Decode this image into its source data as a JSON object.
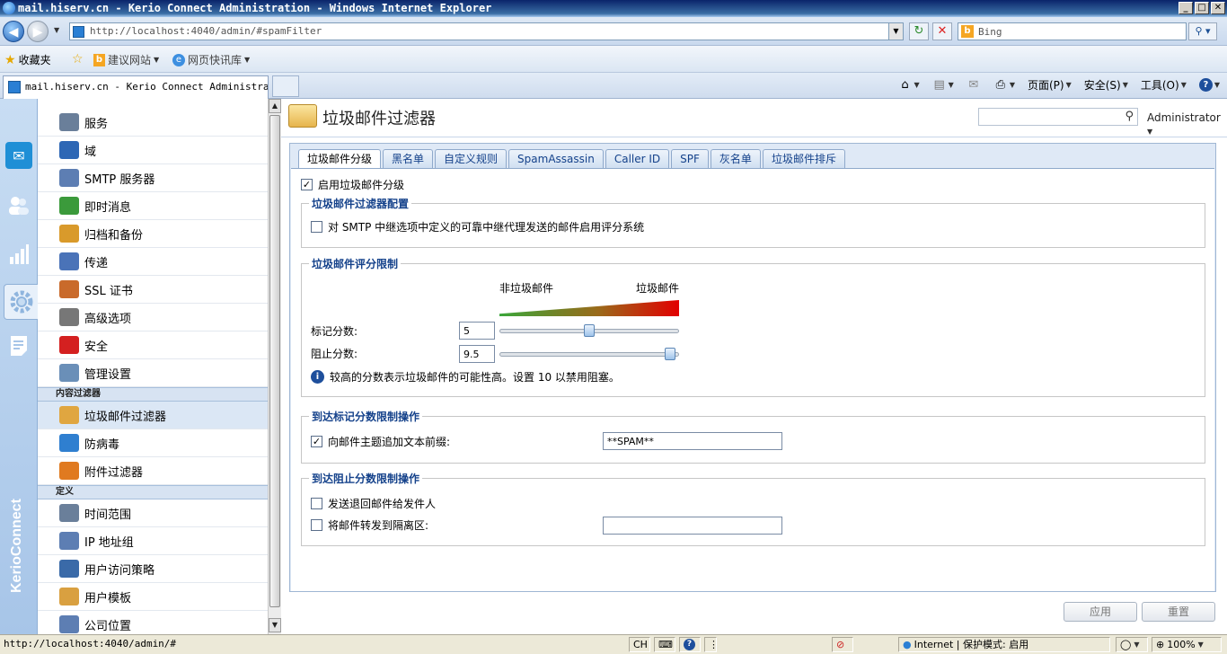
{
  "window": {
    "title": "mail.hiserv.cn - Kerio Connect Administration - Windows Internet Explorer",
    "buttons": {
      "minimize": "_",
      "maximize": "□",
      "close": "✕"
    }
  },
  "browser": {
    "url": "http://localhost:4040/admin/#spamFilter",
    "search_placeholder": "Bing",
    "favorites_label": "收藏夹",
    "suggested_sites": "建议网站",
    "web_slice_gallery": "网页快讯库",
    "tab_title": "mail.hiserv.cn - Kerio Connect Administra...",
    "commands": {
      "page": "页面(P)",
      "safety": "安全(S)",
      "tools": "工具(O)"
    }
  },
  "sidebar": {
    "items_top": [
      {
        "label": "服务",
        "icon": "services-icon",
        "color": "#6a7f9a"
      },
      {
        "label": "域",
        "icon": "at-sign-icon",
        "color": "#2d67b5"
      },
      {
        "label": "SMTP 服务器",
        "icon": "smtp-server-icon",
        "color": "#5d7eb3"
      },
      {
        "label": "即时消息",
        "icon": "chat-bubbles-icon",
        "color": "#3b9a3b"
      },
      {
        "label": "归档和备份",
        "icon": "archive-icon",
        "color": "#d99a2b"
      },
      {
        "label": "传递",
        "icon": "delivery-icon",
        "color": "#4a73b8"
      },
      {
        "label": "SSL 证书",
        "icon": "certificate-icon",
        "color": "#c96a2b"
      },
      {
        "label": "高级选项",
        "icon": "gears-icon",
        "color": "#777777"
      },
      {
        "label": "安全",
        "icon": "security-hand-icon",
        "color": "#d42020"
      },
      {
        "label": "管理设置",
        "icon": "admin-settings-icon",
        "color": "#6a8fb8"
      }
    ],
    "section_content_filter": "内容过滤器",
    "items_filter": [
      {
        "label": "垃圾邮件过滤器",
        "icon": "spam-filter-icon",
        "color": "#e0a640"
      },
      {
        "label": "防病毒",
        "icon": "antivirus-icon",
        "color": "#2f7fd0"
      },
      {
        "label": "附件过滤器",
        "icon": "attachment-filter-icon",
        "color": "#e07a20"
      }
    ],
    "section_definitions": "定义",
    "items_defs": [
      {
        "label": "时间范围",
        "icon": "time-range-icon",
        "color": "#6a7f9a"
      },
      {
        "label": "IP 地址组",
        "icon": "ip-group-icon",
        "color": "#5d7eb3"
      },
      {
        "label": "用户访问策略",
        "icon": "access-policy-icon",
        "color": "#3a6aa8"
      },
      {
        "label": "用户模板",
        "icon": "user-template-icon",
        "color": "#d9a040"
      },
      {
        "label": "公司位置",
        "icon": "company-location-icon",
        "color": "#5d7eb3"
      }
    ],
    "brand": "KerioConnect"
  },
  "header": {
    "title": "垃圾邮件过滤器",
    "user_menu": "Administrator"
  },
  "tabs": [
    "垃圾邮件分级",
    "黑名单",
    "自定义规则",
    "SpamAssassin",
    "Caller ID",
    "SPF",
    "灰名单",
    "垃圾邮件排斥"
  ],
  "form": {
    "enable_rating": "启用垃圾邮件分级",
    "config_legend": "垃圾邮件过滤器配置",
    "trusted_relay": "对 SMTP 中继选项中定义的可靠中继代理发送的邮件启用评分系统",
    "score_legend": "垃圾邮件评分限制",
    "not_spam": "非垃圾邮件",
    "spam": "垃圾邮件",
    "tag_label": "标记分数:",
    "tag_value": "5",
    "block_label": "阻止分数:",
    "block_value": "9.5",
    "hint": "较高的分数表示垃圾邮件的可能性高。设置 10 以禁用阻塞。",
    "tag_action_legend": "到达标记分数限制操作",
    "prefix_label": "向邮件主题追加文本前缀:",
    "prefix_value": "**SPAM**",
    "block_action_legend": "到达阻止分数限制操作",
    "bounce_label": "发送退回邮件给发件人",
    "quarantine_label": "将邮件转发到隔离区:",
    "quarantine_value": ""
  },
  "slider_levels": {
    "tag": 0.5,
    "block": 0.95
  },
  "buttons": {
    "apply": "应用",
    "reset": "重置"
  },
  "statusbar": {
    "url": "http://localhost:4040/admin/#",
    "ime": "CH",
    "zone": "Internet | 保护模式: 启用",
    "zoom": "100%"
  }
}
